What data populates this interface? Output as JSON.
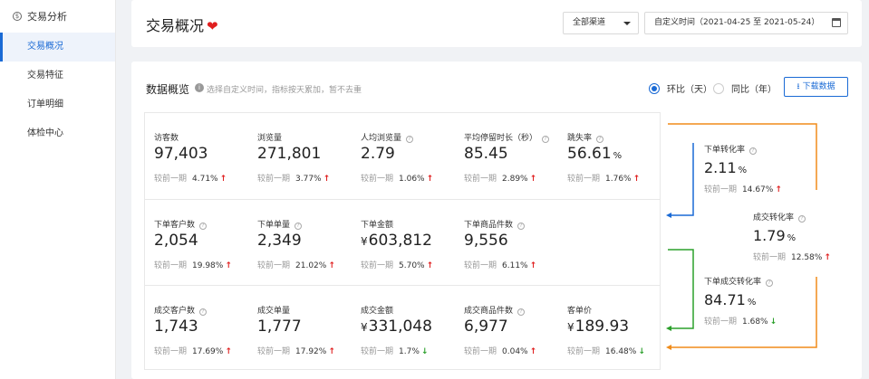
{
  "sidebar": {
    "header": "交易分析",
    "items": [
      {
        "label": "交易概况",
        "active": true
      },
      {
        "label": "交易特征",
        "active": false
      },
      {
        "label": "订单明细",
        "active": false
      },
      {
        "label": "体检中心",
        "active": false
      }
    ]
  },
  "header": {
    "title": "交易概况",
    "heart_icon": "heart-icon",
    "channel": "全部渠道",
    "date_range": "自定义时间（2021-04-25 至 2021-05-24）"
  },
  "overview": {
    "title": "数据概览",
    "hint": "选择自定义时间，指标按天累加，暂不去重",
    "radio_day": "环比（天）",
    "radio_year": "同比（年）",
    "selected_radio": "day",
    "download": "下载数据",
    "compare_label": "较前一期",
    "metrics": [
      {
        "label": "访客数",
        "value": "97,403",
        "change": "4.71%",
        "dir": "up",
        "help": false
      },
      {
        "label": "浏览量",
        "value": "271,801",
        "change": "3.77%",
        "dir": "up",
        "help": false
      },
      {
        "label": "人均浏览量",
        "value": "2.79",
        "change": "1.06%",
        "dir": "up",
        "help": true
      },
      {
        "label": "平均停留时长（秒）",
        "value": "85.45",
        "change": "2.89%",
        "dir": "up",
        "help": true
      },
      {
        "label": "跳失率",
        "value": "56.61",
        "unit": "%",
        "change": "1.76%",
        "dir": "up",
        "help": true
      },
      {
        "label": "下单客户数",
        "value": "2,054",
        "change": "19.98%",
        "dir": "up",
        "help": true
      },
      {
        "label": "下单单量",
        "value": "2,349",
        "change": "21.02%",
        "dir": "up",
        "help": true
      },
      {
        "label": "下单金额",
        "prefix": "¥",
        "value": "603,812",
        "change": "5.70%",
        "dir": "up",
        "help": false
      },
      {
        "label": "下单商品件数",
        "value": "9,556",
        "change": "6.11%",
        "dir": "up",
        "help": true
      },
      {
        "label": "成交客户数",
        "value": "1,743",
        "change": "17.69%",
        "dir": "up",
        "help": true
      },
      {
        "label": "成交单量",
        "value": "1,777",
        "change": "17.92%",
        "dir": "up",
        "help": false
      },
      {
        "label": "成交金额",
        "prefix": "¥",
        "value": "331,048",
        "change": "1.7%",
        "dir": "down",
        "help": false
      },
      {
        "label": "成交商品件数",
        "value": "6,977",
        "change": "0.04%",
        "dir": "up",
        "help": true
      },
      {
        "label": "客单价",
        "prefix": "¥",
        "value": "189.93",
        "change": "16.48%",
        "dir": "down",
        "help": false
      }
    ],
    "conversions": [
      {
        "label": "下单转化率",
        "value": "2.11",
        "unit": "%",
        "change": "14.67%",
        "dir": "up"
      },
      {
        "label": "成交转化率",
        "value": "1.79",
        "unit": "%",
        "change": "12.58%",
        "dir": "up"
      },
      {
        "label": "下单成交转化率",
        "value": "84.71",
        "unit": "%",
        "change": "1.68%",
        "dir": "down"
      }
    ],
    "colors": {
      "accent": "#1a6ad5",
      "up": "#e02020",
      "down": "#2ca02c",
      "flow_orange": "#f08c1a",
      "flow_blue": "#1a6ad5",
      "flow_green": "#2ca02c"
    }
  }
}
